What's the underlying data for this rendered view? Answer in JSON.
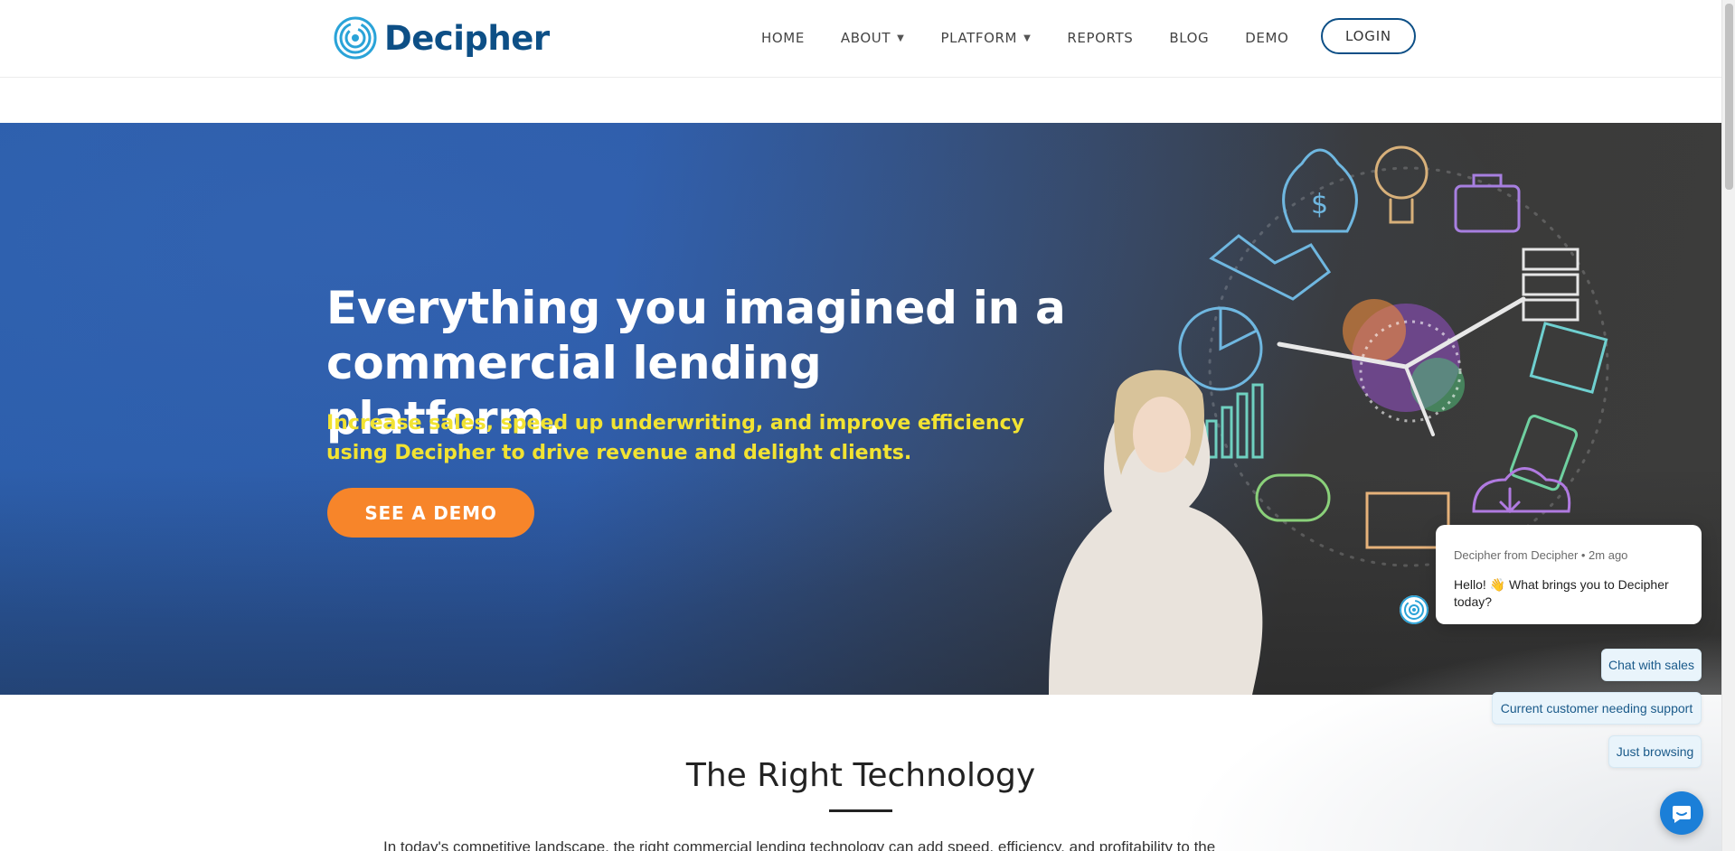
{
  "header": {
    "logo_text": "Decipher",
    "nav": [
      {
        "label": "HOME"
      },
      {
        "label": "ABOUT"
      },
      {
        "label": "PLATFORM"
      },
      {
        "label": "REPORTS"
      },
      {
        "label": "BLOG"
      },
      {
        "label": "DEMO"
      }
    ],
    "login_label": "LOGIN"
  },
  "hero": {
    "title": "Everything you imagined in a commercial lending platform.",
    "subtitle": "Increase sales, speed up underwriting, and improve efficiency using Decipher to drive revenue and delight clients.",
    "cta_label": "SEE A DEMO"
  },
  "section": {
    "title": "The Right Technology",
    "body": "In today's competitive landscape, the right commercial lending technology can add speed, efficiency, and profitability to the"
  },
  "chat": {
    "meta": "Decipher from Decipher • 2m ago",
    "message": "Hello! 👋 What brings you to Decipher today?",
    "options": [
      {
        "label": "Chat with sales"
      },
      {
        "label": "Current customer needing support"
      },
      {
        "label": "Just browsing"
      }
    ]
  },
  "colors": {
    "brand": "#0d4f86",
    "hero_blue": "#2b5daa",
    "accent_orange": "#f7852a",
    "subtitle_yellow": "#f2e332",
    "chat_blue": "#1b7fd8"
  },
  "icons": [
    "logo-maze-icon",
    "chevron-down-icon",
    "chat-bubble-icon"
  ]
}
